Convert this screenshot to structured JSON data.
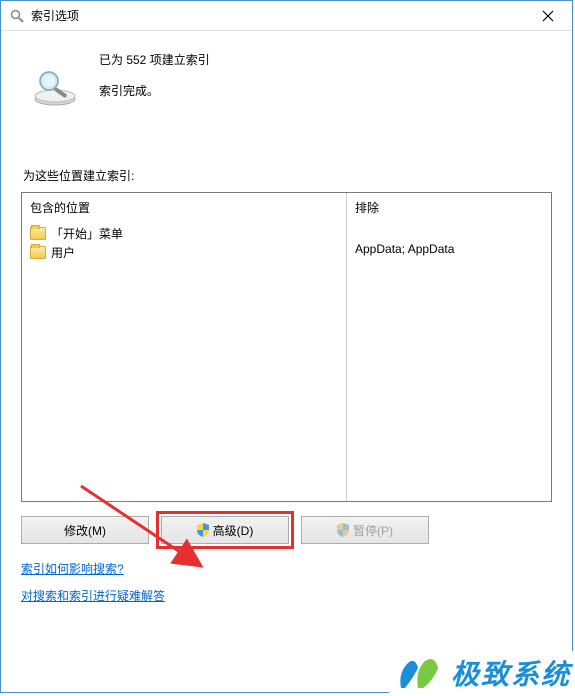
{
  "titlebar": {
    "title": "索引选项"
  },
  "status": {
    "line1": "已为 552 项建立索引",
    "line2": "索引完成。"
  },
  "section_label": "为这些位置建立索引:",
  "columns": {
    "included_header": "包含的位置",
    "excluded_header": "排除"
  },
  "locations": [
    {
      "name": "「开始」菜单",
      "exclude": ""
    },
    {
      "name": "用户",
      "exclude": "AppData; AppData"
    }
  ],
  "buttons": {
    "modify": "修改(M)",
    "advanced": "高级(D)",
    "pause": "暂停(P)"
  },
  "links": {
    "how_affects": "索引如何影响搜索?",
    "troubleshoot": "对搜索和索引进行疑难解答"
  },
  "watermark": {
    "text": "极致系统"
  }
}
